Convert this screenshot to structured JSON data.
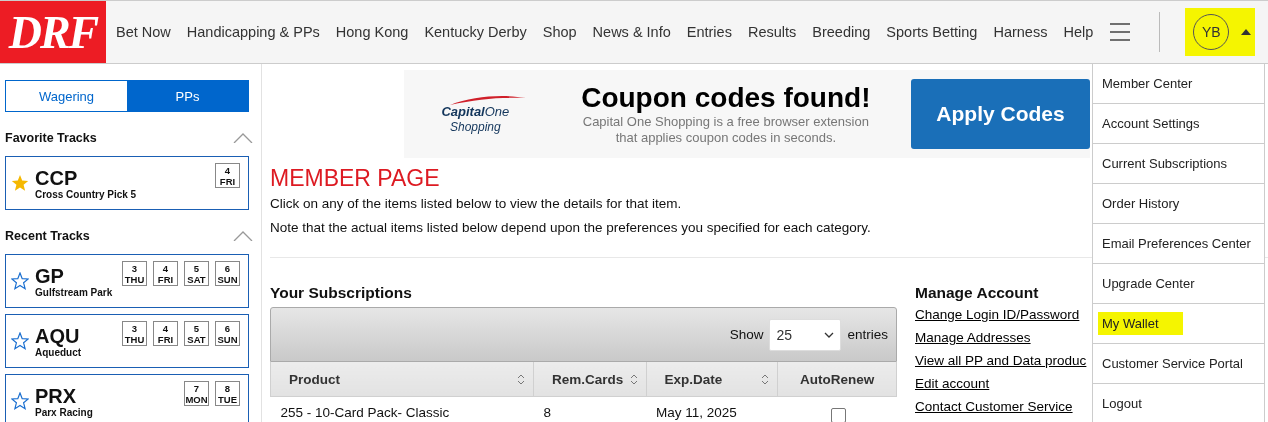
{
  "header": {
    "logo": "DRF",
    "nav": [
      "Bet Now",
      "Handicapping & PPs",
      "Hong Kong",
      "Kentucky Derby",
      "Shop",
      "News & Info",
      "Entries",
      "Results",
      "Breeding",
      "Sports Betting",
      "Harness",
      "Help"
    ],
    "avatar": {
      "initials": "YB",
      "highlighted": true
    },
    "menu_open": true
  },
  "user_menu": [
    {
      "label": "Member Center",
      "highlighted": false
    },
    {
      "label": "Account Settings",
      "highlighted": false
    },
    {
      "label": "Current Subscriptions",
      "highlighted": false
    },
    {
      "label": "Order History",
      "highlighted": false
    },
    {
      "label": "Email Preferences Center",
      "highlighted": false
    },
    {
      "label": "Upgrade Center",
      "highlighted": false
    },
    {
      "label": "My Wallet",
      "highlighted": true
    },
    {
      "label": "Customer Service Portal",
      "highlighted": false
    },
    {
      "label": "Logout",
      "highlighted": false
    }
  ],
  "sidebar": {
    "tabs": [
      {
        "label": "Wagering",
        "selected": false
      },
      {
        "label": "PPs",
        "selected": true
      }
    ],
    "sections": [
      {
        "title": "Favorite Tracks",
        "expanded": true,
        "tracks": [
          {
            "code": "CCP",
            "name": "Cross Country Pick 5",
            "favorite": true,
            "days": [
              {
                "date": "4",
                "day": "FRI"
              }
            ]
          }
        ]
      },
      {
        "title": "Recent Tracks",
        "expanded": true,
        "tracks": [
          {
            "code": "GP",
            "name": "Gulfstream Park",
            "favorite": false,
            "days": [
              {
                "date": "3",
                "day": "THU"
              },
              {
                "date": "4",
                "day": "FRI"
              },
              {
                "date": "5",
                "day": "SAT"
              },
              {
                "date": "6",
                "day": "SUN"
              }
            ]
          },
          {
            "code": "AQU",
            "name": "Aqueduct",
            "favorite": false,
            "days": [
              {
                "date": "3",
                "day": "THU"
              },
              {
                "date": "4",
                "day": "FRI"
              },
              {
                "date": "5",
                "day": "SAT"
              },
              {
                "date": "6",
                "day": "SUN"
              }
            ]
          },
          {
            "code": "PRX",
            "name": "Parx Racing",
            "favorite": false,
            "days": [
              {
                "date": "7",
                "day": "MON"
              },
              {
                "date": "8",
                "day": "TUE"
              }
            ]
          }
        ]
      }
    ]
  },
  "ad": {
    "logo": "**Capital**One",
    "logo_sub": "Shopping",
    "headline": "Coupon codes found!",
    "body": "Capital One Shopping is a free browser extension that applies coupon codes in seconds.",
    "button": "Apply Codes"
  },
  "main": {
    "title": "MEMBER PAGE",
    "paragraphs": [
      "Click on any of the items listed below to view the details for that item.",
      "Note that the actual items listed below depend upon the preferences you specified for each category."
    ]
  },
  "subscriptions": {
    "title": "Your Subscriptions",
    "show_label": "Show",
    "page_size": "25",
    "entries_label": "entries",
    "columns": [
      {
        "label": "Product",
        "sortable": true
      },
      {
        "label": "Rem.Cards",
        "sortable": true
      },
      {
        "label": "Exp.Date",
        "sortable": true
      },
      {
        "label": "AutoRenew",
        "sortable": false
      }
    ],
    "rows": [
      {
        "product": "255 - 10-Card Pack- Classic",
        "rem_cards": "8",
        "exp_date": "May 11, 2025",
        "auto_renew": false
      }
    ]
  },
  "manage_account": {
    "title": "Manage Account",
    "links": [
      "Change Login ID/Password",
      "Manage Addresses",
      "View all PP and Data produc",
      "Edit account",
      "Contact Customer Service"
    ]
  }
}
